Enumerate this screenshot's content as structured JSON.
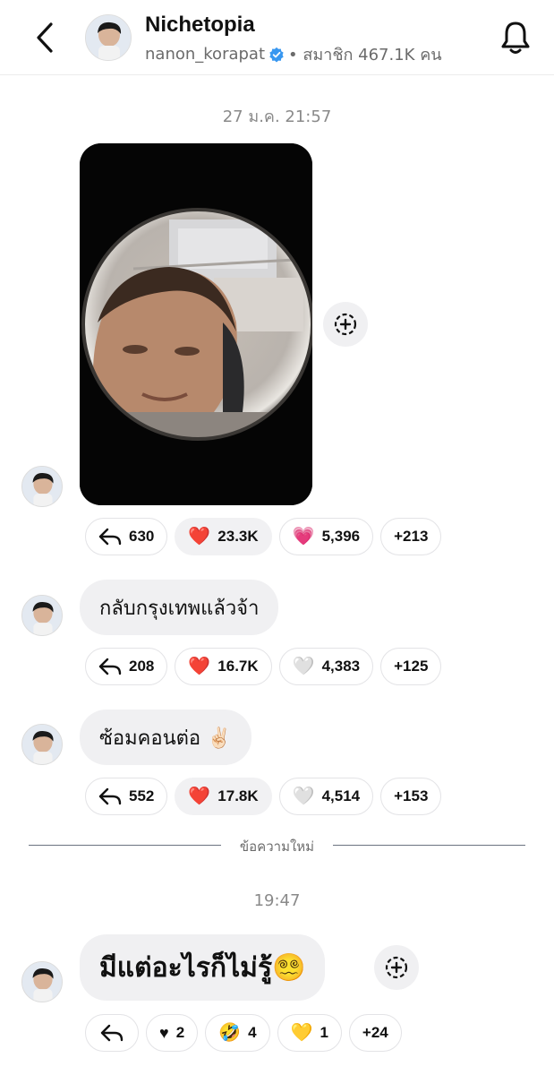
{
  "header": {
    "title": "Nichetopia",
    "username": "nanon_korapat",
    "members": "• สมาชิก 467.1K คน"
  },
  "timestamps": {
    "first": "27 ม.ค. 21:57",
    "second": "19:47"
  },
  "divider_label": "ข้อความใหม่",
  "messages": [
    {
      "kind": "photo",
      "reactions": {
        "reply": "630",
        "r1_emoji": "❤️",
        "r1": "23.3K",
        "r2_emoji": "💗",
        "r2": "5,396",
        "more": "+213"
      }
    },
    {
      "kind": "text",
      "text": "กลับกรุงเทพแล้วจ้า",
      "reactions": {
        "reply": "208",
        "r1_emoji": "❤️",
        "r1": "16.7K",
        "r2_emoji": "🤍",
        "r2": "4,383",
        "more": "+125"
      }
    },
    {
      "kind": "text",
      "text": "ซ้อมคอนต่อ ✌🏻",
      "reactions": {
        "reply": "552",
        "r1_emoji": "❤️",
        "r1": "17.8K",
        "r2_emoji": "🤍",
        "r2": "4,514",
        "more": "+153"
      }
    },
    {
      "kind": "text",
      "text": "มีแต่อะไรก็ไม่รู้😵‍💫",
      "reactions": {
        "reply": "",
        "r1_emoji": "♥",
        "r1": "2",
        "r2_emoji": "🤣",
        "r2": "4",
        "r3_emoji": "💛",
        "r3": "1",
        "more": "+24"
      }
    }
  ],
  "colors": {
    "accent_verified": "#3897f0",
    "bubble": "#f0f0f2",
    "muted_text": "#8a8a8a"
  },
  "icons": [
    "back-arrow-icon",
    "bell-icon",
    "verified-icon",
    "reply-icon",
    "add-reaction-icon"
  ]
}
